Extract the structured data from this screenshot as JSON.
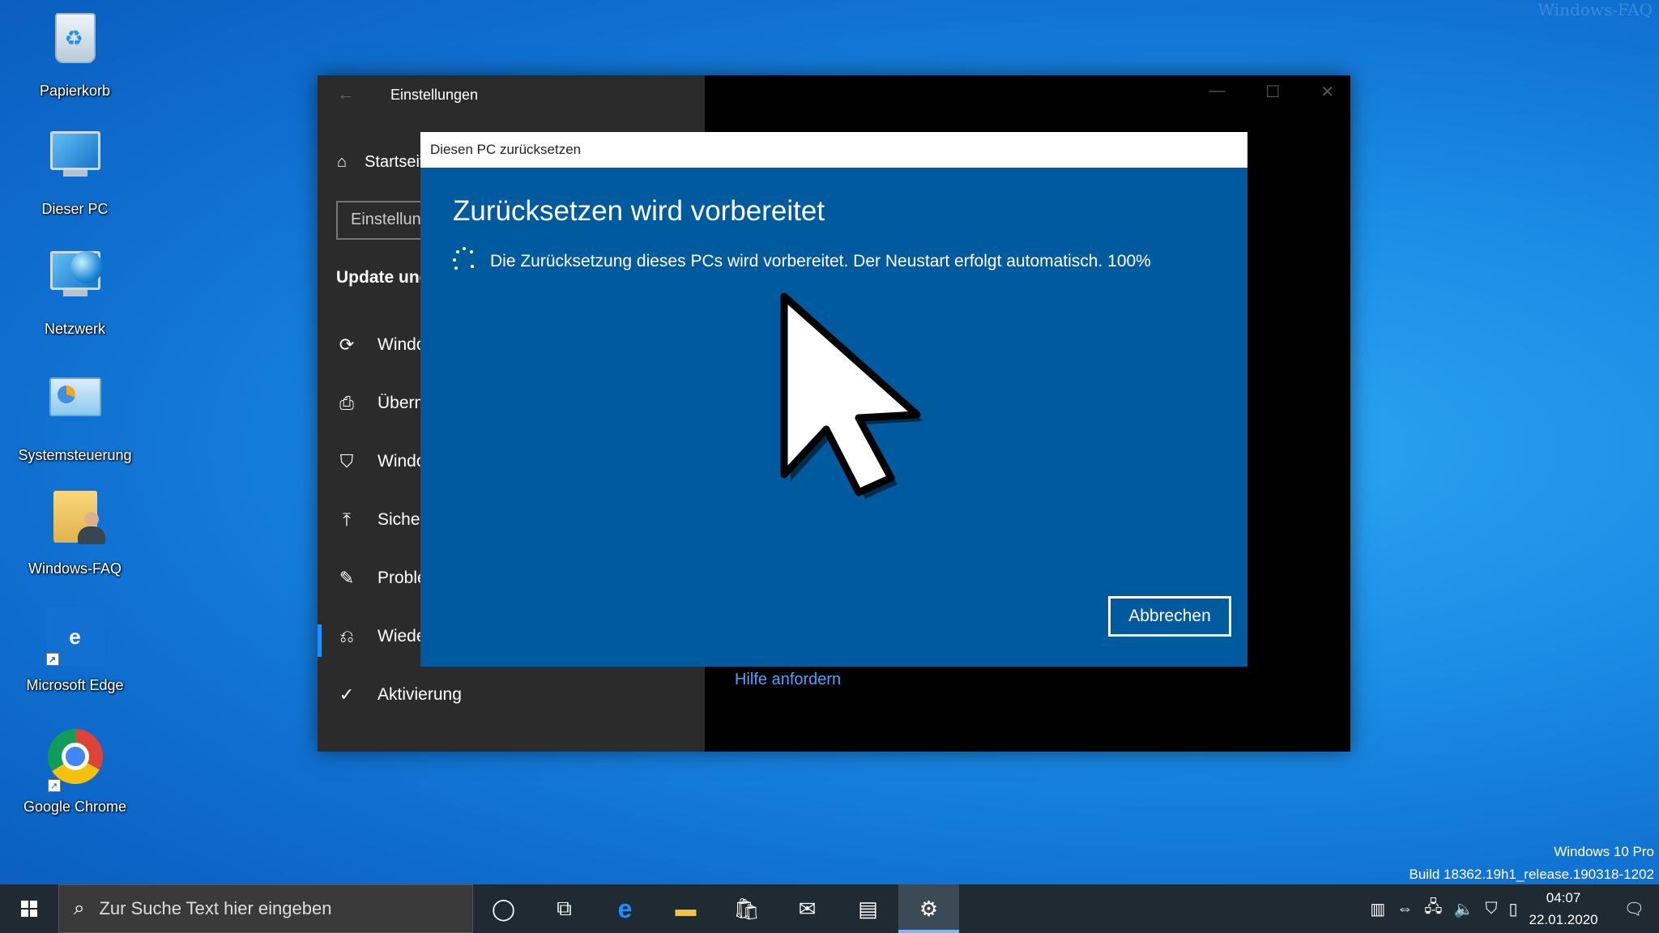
{
  "watermark": "Windows-FAQ",
  "desktop": {
    "icons": [
      {
        "label": "Papierkorb"
      },
      {
        "label": "Dieser PC"
      },
      {
        "label": "Netzwerk"
      },
      {
        "label": "Systemsteuerung"
      },
      {
        "label": "Windows-FAQ"
      },
      {
        "label": "Microsoft Edge"
      },
      {
        "label": "Google Chrome"
      }
    ]
  },
  "settings": {
    "title": "Einstellungen",
    "home_label": "Startseite",
    "search_placeholder": "Einstellung suchen",
    "section_heading": "Update und Sicherheit",
    "nav": [
      {
        "label": "Windows Update",
        "icon": "refresh-icon"
      },
      {
        "label": "Übermittlungsoptimierung",
        "icon": "delivery-icon"
      },
      {
        "label": "Windows-Sicherheit",
        "icon": "shield-icon"
      },
      {
        "label": "Sicherung",
        "icon": "upload-icon"
      },
      {
        "label": "Problembehandlung",
        "icon": "wrench-icon"
      },
      {
        "label": "Wiederherstellung",
        "icon": "recovery-icon",
        "selected": true
      },
      {
        "label": "Aktivierung",
        "icon": "check-circle-icon"
      }
    ],
    "help_link": "Hilfe anfordern"
  },
  "dialog": {
    "title": "Diesen PC zurücksetzen",
    "heading": "Zurücksetzen wird vorbereitet",
    "status": "Die Zurücksetzung dieses PCs wird vorbereitet. Der Neustart erfolgt automatisch. 100%",
    "progress_percent": 100,
    "cancel_label": "Abbrechen"
  },
  "os_info": {
    "edition": "Windows 10 Pro",
    "build": "Build 18362.19h1_release.190318-1202"
  },
  "taskbar": {
    "search_placeholder": "Zur Suche Text hier eingeben",
    "time": "04:07",
    "date": "22.01.2020"
  }
}
